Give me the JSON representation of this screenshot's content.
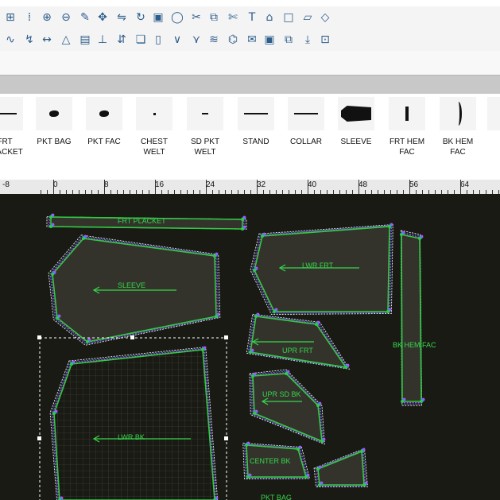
{
  "toolbar_row1": {
    "icons": [
      "grid-snap-icon",
      "grid-dots-icon",
      "add-point-icon",
      "add-notch-icon",
      "edit-point-icon",
      "move-point-icon",
      "mirror-icon",
      "rotate-icon",
      "piece-properties-icon",
      "circle-icon",
      "sew-icon",
      "copy-piece-icon",
      "cut-piece-icon",
      "text-icon",
      "shape-icon",
      "rectangle-icon",
      "parallelogram-icon",
      "diamond-icon"
    ]
  },
  "toolbar_row2": {
    "icons": [
      "curve-icon",
      "cut-line-icon",
      "measure-icon",
      "triangle-icon",
      "table-icon",
      "notch-icon",
      "grade-icon",
      "pattern-copy-icon",
      "page-icon",
      "vertical-notch-icon",
      "dart-icon",
      "pleat-icon",
      "fold-icon",
      "mail-icon",
      "piece-select-icon",
      "duplicate-icon",
      "export-icon",
      "lock-icon"
    ]
  },
  "pieces": [
    {
      "label": "FRT\nPLACKET",
      "shape": "line"
    },
    {
      "label": "PKT BAG",
      "shape": "blob"
    },
    {
      "label": "PKT FAC",
      "shape": "blob"
    },
    {
      "label": "CHEST\nWELT",
      "shape": "dot"
    },
    {
      "label": "SD PKT\nWELT",
      "shape": "dash"
    },
    {
      "label": "STAND",
      "shape": "line"
    },
    {
      "label": "COLLAR",
      "shape": "line"
    },
    {
      "label": "SLEEVE",
      "shape": "sleeve"
    },
    {
      "label": "FRT HEM\nFAC",
      "shape": "vbar"
    },
    {
      "label": "BK HEM\nFAC",
      "shape": "curve"
    },
    {
      "label": "",
      "shape": "partial"
    }
  ],
  "ruler": {
    "labels": [
      "-8",
      "0",
      "8",
      "16",
      "24",
      "32",
      "40",
      "48",
      "56",
      "64"
    ]
  },
  "canvas_labels": {
    "frt_placket": "FRT PLACKET",
    "sleeve": "SLEEVE",
    "lwr_frt": "LWR FRT",
    "upr_frt": "UPR FRT",
    "bk_hem_fac": "BK HEM FAC",
    "upr_sd_bk": "UPR SD BK",
    "lwr_bk": "LWR BK",
    "center_bk": "CENTER BK",
    "pkt_bag": "PKT BAG"
  },
  "colors": {
    "canvas_bg": "#1a1a15",
    "piece_outline": "#2ecc40",
    "grade_magenta": "#d946ef",
    "grade_blue": "#4f7bff",
    "grade_white": "#f0f0f0",
    "label_green": "#37d64a"
  }
}
